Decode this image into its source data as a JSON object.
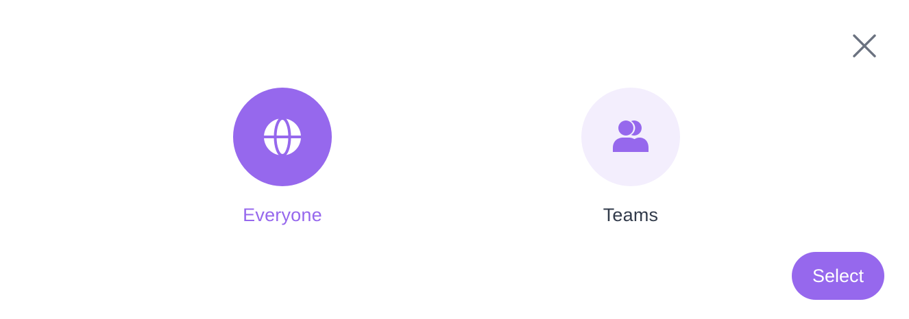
{
  "dialog": {
    "close_icon": "close-icon",
    "options": [
      {
        "label": "Everyone",
        "icon": "globe-icon",
        "selected": true
      },
      {
        "label": "Teams",
        "icon": "users-icon",
        "selected": false
      }
    ],
    "select_label": "Select"
  },
  "colors": {
    "accent": "#9668ED",
    "accent_light": "#F3EEFD",
    "text_dark": "#323B4B",
    "icon_gray": "#6B7280",
    "white": "#FFFFFF"
  }
}
